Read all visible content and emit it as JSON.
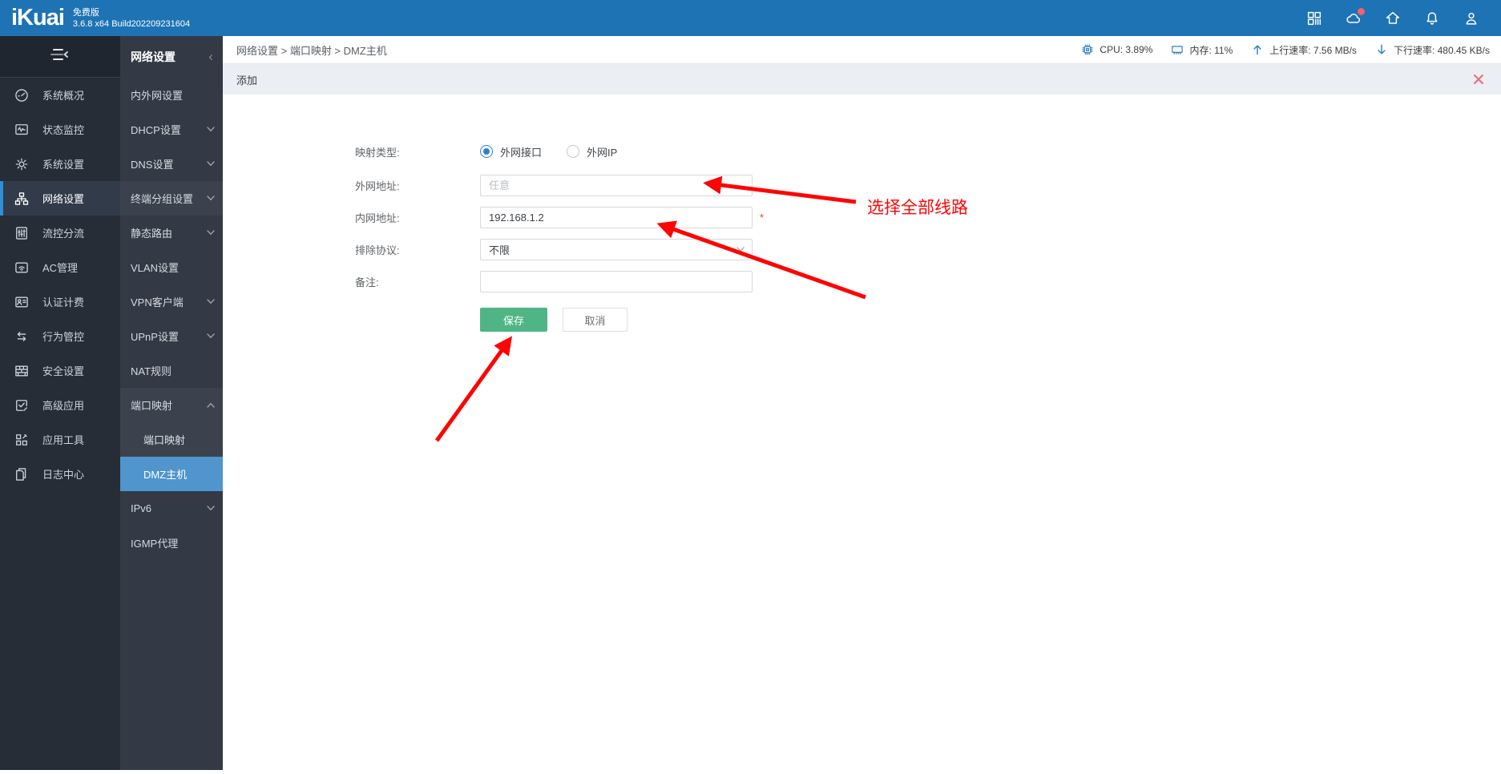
{
  "topbar": {
    "logo_text": "iKuai",
    "edition": "免费版",
    "build": "3.6.8 x64 Build202209231604",
    "icons": [
      {
        "name": "apps-grid-icon"
      },
      {
        "name": "cloud-icon",
        "badge": true
      },
      {
        "name": "home-icon"
      },
      {
        "name": "bell-icon"
      },
      {
        "name": "user-icon"
      }
    ],
    "background": "#1e73b5"
  },
  "primary_nav": {
    "items": [
      {
        "icon": "gauge-icon",
        "label": "系统概况",
        "active": false
      },
      {
        "icon": "monitor-icon",
        "label": "状态监控",
        "active": false
      },
      {
        "icon": "gear-icon",
        "label": "系统设置",
        "active": false
      },
      {
        "icon": "network-icon",
        "label": "网络设置",
        "active": true
      },
      {
        "icon": "traffic-icon",
        "label": "流控分流",
        "active": false
      },
      {
        "icon": "wifi-icon",
        "label": "AC管理",
        "active": false
      },
      {
        "icon": "id-card-icon",
        "label": "认证计费",
        "active": false
      },
      {
        "icon": "swap-arrows-icon",
        "label": "行为管控",
        "active": false
      },
      {
        "icon": "firewall-icon",
        "label": "安全设置",
        "active": false
      },
      {
        "icon": "app-check-icon",
        "label": "高级应用",
        "active": false
      },
      {
        "icon": "tools-icon",
        "label": "应用工具",
        "active": false
      },
      {
        "icon": "logs-icon",
        "label": "日志中心",
        "active": false
      }
    ]
  },
  "secondary_nav": {
    "title": "网络设置",
    "items": [
      {
        "label": "内外网设置"
      },
      {
        "label": "DHCP设置",
        "chevron": "down"
      },
      {
        "label": "DNS设置",
        "chevron": "down"
      },
      {
        "label": "终端分组设置",
        "chevron": "down",
        "highlighted": true
      },
      {
        "label": "静态路由",
        "chevron": "down"
      },
      {
        "label": "VLAN设置"
      },
      {
        "label": "VPN客户端",
        "chevron": "down"
      },
      {
        "label": "UPnP设置",
        "chevron": "down"
      },
      {
        "label": "NAT规则"
      },
      {
        "label": "端口映射",
        "chevron": "up",
        "expanded": true,
        "children": [
          {
            "label": "端口映射",
            "active": false
          },
          {
            "label": "DMZ主机",
            "active": true
          }
        ]
      },
      {
        "label": "IPv6",
        "chevron": "down"
      },
      {
        "label": "IGMP代理"
      }
    ],
    "active_color": "#5095ce"
  },
  "breadcrumb": {
    "path": "网络设置 > 端口映射 > DMZ主机"
  },
  "status_bar": {
    "items": [
      {
        "icon": "cpu-icon",
        "text": "CPU: 3.89%"
      },
      {
        "icon": "memory-icon",
        "text": "内存: 11%"
      },
      {
        "icon": "arrow-up-icon",
        "text": "上行速率: 7.56 MB/s"
      },
      {
        "icon": "arrow-down-icon",
        "text": "下行速率: 480.45 KB/s"
      }
    ],
    "icon_color": "#2c80c4"
  },
  "panel": {
    "title": "添加"
  },
  "form": {
    "mapping_type": {
      "label": "映射类型:",
      "options": [
        {
          "label": "外网接口",
          "selected": true
        },
        {
          "label": "外网IP",
          "selected": false
        }
      ]
    },
    "wan_address": {
      "label": "外网地址:",
      "placeholder": "任意",
      "value": ""
    },
    "lan_address": {
      "label": "内网地址:",
      "value": "192.168.1.2",
      "required_mark": "*"
    },
    "exclude_protocol": {
      "label": "排除协议:",
      "value": "不限"
    },
    "remark": {
      "label": "备注:",
      "value": ""
    },
    "save_label": "保存",
    "cancel_label": "取消",
    "save_color": "#4fb585"
  },
  "annotations": {
    "note": "选择全部线路",
    "color": "#fd0505"
  }
}
